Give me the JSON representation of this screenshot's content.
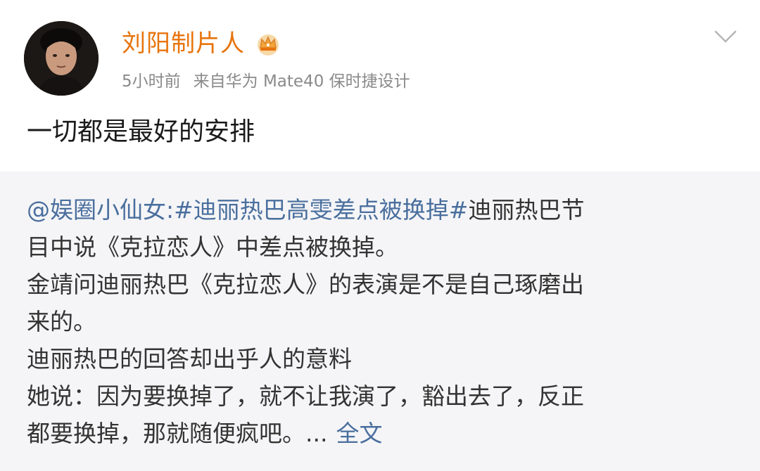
{
  "author": {
    "name": "刘阳制片人",
    "badge_icon": "crown-icon"
  },
  "meta": {
    "time": "5小时前",
    "source": "来自华为 Mate40 保时捷设计"
  },
  "post": {
    "text": "一切都是最好的安排"
  },
  "quoted": {
    "mention": "@娱圈小仙女:",
    "hashtag": "#迪丽热巴高雯差点被换掉#",
    "line1_rest": "迪丽热巴节",
    "line2": "目中说《克拉恋人》中差点被换掉。",
    "line3": "金靖问迪丽热巴《克拉恋人》的表演是不是自己琢磨出",
    "line4": "来的。",
    "line5": "迪丽热巴的回答却出乎人的意料",
    "line6": "她说：因为要换掉了，就不让我演了，豁出去了，反正",
    "line7": "都要换掉，那就随便疯吧。...",
    "more_label": "全文"
  },
  "colors": {
    "username": "#e8740c",
    "link": "#4a6f9e",
    "quote_bg": "#f5f5f7"
  }
}
